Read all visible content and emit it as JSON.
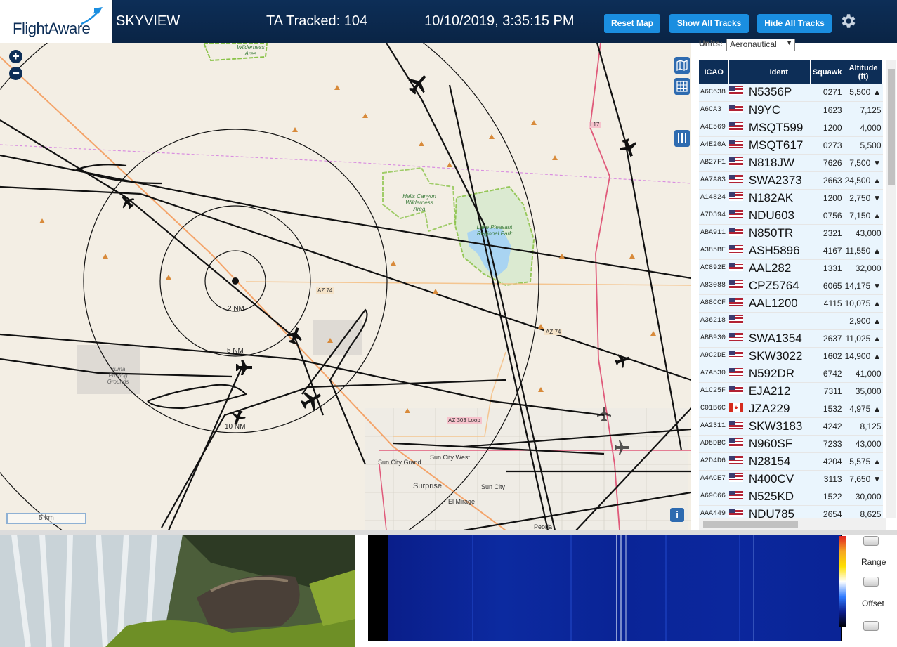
{
  "header": {
    "logo_text": "FlightAware",
    "app_title": "SKYVIEW",
    "ta_tracked": "TA Tracked: 104",
    "datetime": "10/10/2019, 3:35:15 PM",
    "reset_map": "Reset Map",
    "show_all_tracks": "Show All Tracks",
    "hide_all_tracks": "Hide All Tracks",
    "settings_icon": "gear-icon"
  },
  "map": {
    "zoom_in": "+",
    "zoom_out": "−",
    "range_labels": [
      "2 NM",
      "5 NM",
      "10 NM"
    ],
    "place_labels": {
      "wilderness": "Wilderness Area",
      "hells_canyon": "Hells Canyon Wilderness Area",
      "lake_pleasant": "Lake Pleasant Regional Park",
      "yuma": "Yuma Proving Grounds",
      "sun_city_grand": "Sun City Grand",
      "sun_city_west": "Sun City West",
      "sun_city": "Sun City",
      "surprise": "Surprise",
      "el_mirage": "El Mirage",
      "peoria": "Peoria",
      "az74_a": "AZ 74",
      "az74_b": "AZ 74",
      "az303": "AZ 303 Loop",
      "i17": "I 17"
    },
    "scale_text": "5 km",
    "info": "i"
  },
  "table": {
    "units_label": "Units:",
    "units_value": "Aeronautical",
    "headers": {
      "icao": "ICAO",
      "ident": "Ident",
      "squawk": "Squawk",
      "altitude": "Altitude (ft)"
    },
    "rows": [
      {
        "icao": "A6C638",
        "flag": "us",
        "ident": "N5356P",
        "squawk": "0271",
        "alt": "5,500 ▲"
      },
      {
        "icao": "A6CA3",
        "flag": "us",
        "ident": "N9YC",
        "squawk": "1623",
        "alt": "7,125"
      },
      {
        "icao": "A4E569",
        "flag": "us",
        "ident": "MSQT599",
        "squawk": "1200",
        "alt": "4,000"
      },
      {
        "icao": "A4E20A",
        "flag": "us",
        "ident": "MSQT617",
        "squawk": "0273",
        "alt": "5,500"
      },
      {
        "icao": "AB27F1",
        "flag": "us",
        "ident": "N818JW",
        "squawk": "7626",
        "alt": "7,500 ▼"
      },
      {
        "icao": "AA7A83",
        "flag": "us",
        "ident": "SWA2373",
        "squawk": "2663",
        "alt": "24,500 ▲"
      },
      {
        "icao": "A14824",
        "flag": "us",
        "ident": "N182AK",
        "squawk": "1200",
        "alt": "2,750 ▼"
      },
      {
        "icao": "A7D394",
        "flag": "us",
        "ident": "NDU603",
        "squawk": "0756",
        "alt": "7,150 ▲"
      },
      {
        "icao": "ABA911",
        "flag": "us",
        "ident": "N850TR",
        "squawk": "2321",
        "alt": "43,000"
      },
      {
        "icao": "A385BE",
        "flag": "us",
        "ident": "ASH5896",
        "squawk": "4167",
        "alt": "11,550 ▲"
      },
      {
        "icao": "AC892E",
        "flag": "us",
        "ident": "AAL282",
        "squawk": "1331",
        "alt": "32,000"
      },
      {
        "icao": "A83088",
        "flag": "us",
        "ident": "CPZ5764",
        "squawk": "6065",
        "alt": "14,175 ▼"
      },
      {
        "icao": "A88CCF",
        "flag": "us",
        "ident": "AAL1200",
        "squawk": "4115",
        "alt": "10,075 ▲"
      },
      {
        "icao": "A36218",
        "flag": "us",
        "ident": "",
        "squawk": "",
        "alt": "2,900 ▲"
      },
      {
        "icao": "ABB930",
        "flag": "us",
        "ident": "SWA1354",
        "squawk": "2637",
        "alt": "11,025 ▲"
      },
      {
        "icao": "A9C2DE",
        "flag": "us",
        "ident": "SKW3022",
        "squawk": "1602",
        "alt": "14,900 ▲"
      },
      {
        "icao": "A7A530",
        "flag": "us",
        "ident": "N592DR",
        "squawk": "6742",
        "alt": "41,000"
      },
      {
        "icao": "A1C25F",
        "flag": "us",
        "ident": "EJA212",
        "squawk": "7311",
        "alt": "35,000"
      },
      {
        "icao": "C01B6C",
        "flag": "ca",
        "ident": "JZA229",
        "squawk": "1532",
        "alt": "4,975 ▲"
      },
      {
        "icao": "AA2311",
        "flag": "us",
        "ident": "SKW3183",
        "squawk": "4242",
        "alt": "8,125"
      },
      {
        "icao": "AD5DBC",
        "flag": "us",
        "ident": "N960SF",
        "squawk": "7233",
        "alt": "43,000"
      },
      {
        "icao": "A2D4D6",
        "flag": "us",
        "ident": "N28154",
        "squawk": "4204",
        "alt": "5,575 ▲"
      },
      {
        "icao": "A4ACE7",
        "flag": "us",
        "ident": "N400CV",
        "squawk": "3113",
        "alt": "7,650 ▼"
      },
      {
        "icao": "A69C66",
        "flag": "us",
        "ident": "N525KD",
        "squawk": "1522",
        "alt": "30,000"
      },
      {
        "icao": "AAA449",
        "flag": "us",
        "ident": "NDU785",
        "squawk": "2654",
        "alt": "8,625"
      }
    ]
  },
  "spectrogram": {
    "range_label": "Range",
    "offset_label": "Offset"
  },
  "colors": {
    "header_bg": "#0a2445",
    "button_bg": "#1a8ee0",
    "table_header_bg": "#0d2e57",
    "row_bg": "#eaf5fd"
  }
}
